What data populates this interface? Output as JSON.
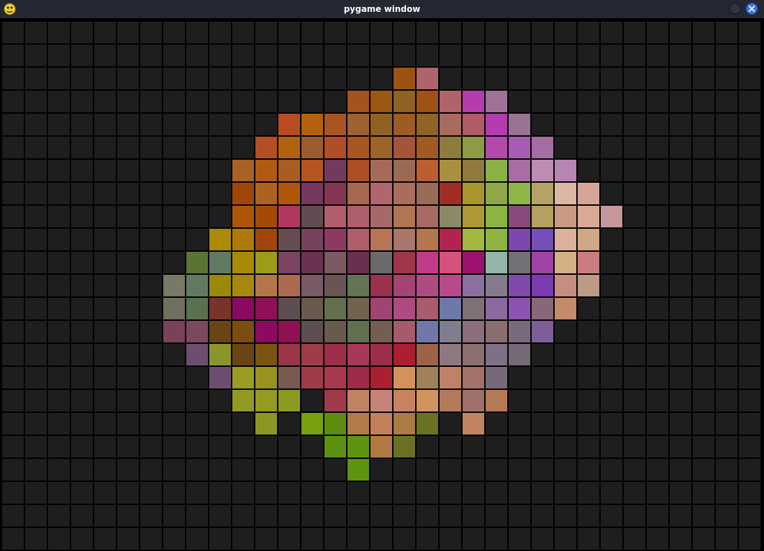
{
  "window": {
    "title": "pygame window",
    "icon": "python-snake-icon",
    "controls": [
      "minimize-icon",
      "close-icon"
    ]
  },
  "board": {
    "columns": 33,
    "rows": 23,
    "empty_color": "#1e1e1e",
    "grid_line_color": "#000000",
    "cells": [
      {
        "r": 2,
        "c": 17,
        "color": "#9c5311"
      },
      {
        "r": 2,
        "c": 18,
        "color": "#b1636b"
      },
      {
        "r": 3,
        "c": 15,
        "color": "#a4521e"
      },
      {
        "r": 3,
        "c": 16,
        "color": "#9c5711"
      },
      {
        "r": 3,
        "c": 17,
        "color": "#8d6223"
      },
      {
        "r": 3,
        "c": 18,
        "color": "#9e5214"
      },
      {
        "r": 3,
        "c": 19,
        "color": "#b0636b"
      },
      {
        "r": 3,
        "c": 20,
        "color": "#b33dac"
      },
      {
        "r": 3,
        "c": 21,
        "color": "#9e7395"
      },
      {
        "r": 4,
        "c": 12,
        "color": "#b84d22"
      },
      {
        "r": 4,
        "c": 13,
        "color": "#b4610c"
      },
      {
        "r": 4,
        "c": 14,
        "color": "#a85523"
      },
      {
        "r": 4,
        "c": 15,
        "color": "#9e6232"
      },
      {
        "r": 4,
        "c": 16,
        "color": "#906222"
      },
      {
        "r": 4,
        "c": 17,
        "color": "#9c5c24"
      },
      {
        "r": 4,
        "c": 18,
        "color": "#8f6424"
      },
      {
        "r": 4,
        "c": 19,
        "color": "#a76c5d"
      },
      {
        "r": 4,
        "c": 20,
        "color": "#b15b67"
      },
      {
        "r": 4,
        "c": 21,
        "color": "#b33db0"
      },
      {
        "r": 4,
        "c": 22,
        "color": "#9a7393"
      },
      {
        "r": 5,
        "c": 11,
        "color": "#b44e24"
      },
      {
        "r": 5,
        "c": 12,
        "color": "#b2620c"
      },
      {
        "r": 5,
        "c": 13,
        "color": "#9c5c32"
      },
      {
        "r": 5,
        "c": 14,
        "color": "#b04e27"
      },
      {
        "r": 5,
        "c": 15,
        "color": "#a85722"
      },
      {
        "r": 5,
        "c": 16,
        "color": "#9c6425"
      },
      {
        "r": 5,
        "c": 17,
        "color": "#a35539"
      },
      {
        "r": 5,
        "c": 18,
        "color": "#a35a22"
      },
      {
        "r": 5,
        "c": 19,
        "color": "#8e7c3c"
      },
      {
        "r": 5,
        "c": 20,
        "color": "#8e9a48"
      },
      {
        "r": 5,
        "c": 21,
        "color": "#b34aaa"
      },
      {
        "r": 5,
        "c": 22,
        "color": "#a85bb5"
      },
      {
        "r": 5,
        "c": 23,
        "color": "#a66ca6"
      },
      {
        "r": 6,
        "c": 10,
        "color": "#a86224"
      },
      {
        "r": 6,
        "c": 11,
        "color": "#b05a14"
      },
      {
        "r": 6,
        "c": 12,
        "color": "#a65e22"
      },
      {
        "r": 6,
        "c": 13,
        "color": "#b55620"
      },
      {
        "r": 6,
        "c": 14,
        "color": "#723b5e"
      },
      {
        "r": 6,
        "c": 15,
        "color": "#ae4e26"
      },
      {
        "r": 6,
        "c": 16,
        "color": "#a86a58"
      },
      {
        "r": 6,
        "c": 17,
        "color": "#9a6a55"
      },
      {
        "r": 6,
        "c": 18,
        "color": "#bb5f32"
      },
      {
        "r": 6,
        "c": 19,
        "color": "#a89040"
      },
      {
        "r": 6,
        "c": 20,
        "color": "#907a40"
      },
      {
        "r": 6,
        "c": 21,
        "color": "#8ab046"
      },
      {
        "r": 6,
        "c": 22,
        "color": "#a86ea4"
      },
      {
        "r": 6,
        "c": 23,
        "color": "#bc8cb2"
      },
      {
        "r": 6,
        "c": 24,
        "color": "#b884b2"
      },
      {
        "r": 7,
        "c": 10,
        "color": "#a24608"
      },
      {
        "r": 7,
        "c": 11,
        "color": "#ae6222"
      },
      {
        "r": 7,
        "c": 12,
        "color": "#b0560a"
      },
      {
        "r": 7,
        "c": 13,
        "color": "#74375e"
      },
      {
        "r": 7,
        "c": 14,
        "color": "#843650"
      },
      {
        "r": 7,
        "c": 15,
        "color": "#a8684e"
      },
      {
        "r": 7,
        "c": 16,
        "color": "#b0666c"
      },
      {
        "r": 7,
        "c": 17,
        "color": "#aa6c5e"
      },
      {
        "r": 7,
        "c": 18,
        "color": "#9a6c58"
      },
      {
        "r": 7,
        "c": 19,
        "color": "#a02e22"
      },
      {
        "r": 7,
        "c": 20,
        "color": "#a8962c"
      },
      {
        "r": 7,
        "c": 21,
        "color": "#8ea848"
      },
      {
        "r": 7,
        "c": 22,
        "color": "#8db646"
      },
      {
        "r": 7,
        "c": 23,
        "color": "#b4a364"
      },
      {
        "r": 7,
        "c": 24,
        "color": "#dab7a4"
      },
      {
        "r": 7,
        "c": 25,
        "color": "#d6a59a"
      },
      {
        "r": 8,
        "c": 10,
        "color": "#ae5608"
      },
      {
        "r": 8,
        "c": 11,
        "color": "#a34a08"
      },
      {
        "r": 8,
        "c": 12,
        "color": "#b0385e"
      },
      {
        "r": 8,
        "c": 13,
        "color": "#624c52"
      },
      {
        "r": 8,
        "c": 14,
        "color": "#b05e6c"
      },
      {
        "r": 8,
        "c": 15,
        "color": "#ae5e6c"
      },
      {
        "r": 8,
        "c": 16,
        "color": "#a8686a"
      },
      {
        "r": 8,
        "c": 17,
        "color": "#b07654"
      },
      {
        "r": 8,
        "c": 18,
        "color": "#a86a62"
      },
      {
        "r": 8,
        "c": 19,
        "color": "#8a8a68"
      },
      {
        "r": 8,
        "c": 20,
        "color": "#b09834"
      },
      {
        "r": 8,
        "c": 21,
        "color": "#8cb442"
      },
      {
        "r": 8,
        "c": 22,
        "color": "#884a7a"
      },
      {
        "r": 8,
        "c": 23,
        "color": "#b4a060"
      },
      {
        "r": 8,
        "c": 24,
        "color": "#c89a84"
      },
      {
        "r": 8,
        "c": 25,
        "color": "#d8aa96"
      },
      {
        "r": 8,
        "c": 26,
        "color": "#c8979c"
      },
      {
        "r": 9,
        "c": 9,
        "color": "#aa8a06"
      },
      {
        "r": 9,
        "c": 10,
        "color": "#ae7a08"
      },
      {
        "r": 9,
        "c": 11,
        "color": "#a04608"
      },
      {
        "r": 9,
        "c": 12,
        "color": "#644e52"
      },
      {
        "r": 9,
        "c": 13,
        "color": "#78425e"
      },
      {
        "r": 9,
        "c": 14,
        "color": "#8c3a62"
      },
      {
        "r": 9,
        "c": 15,
        "color": "#b05e6c"
      },
      {
        "r": 9,
        "c": 16,
        "color": "#b87454"
      },
      {
        "r": 9,
        "c": 17,
        "color": "#a8766a"
      },
      {
        "r": 9,
        "c": 18,
        "color": "#b47650"
      },
      {
        "r": 9,
        "c": 19,
        "color": "#b42350"
      },
      {
        "r": 9,
        "c": 20,
        "color": "#a4b840"
      },
      {
        "r": 9,
        "c": 21,
        "color": "#8eb444"
      },
      {
        "r": 9,
        "c": 22,
        "color": "#7c48b0"
      },
      {
        "r": 9,
        "c": 23,
        "color": "#7650b8"
      },
      {
        "r": 9,
        "c": 24,
        "color": "#dcb09a"
      },
      {
        "r": 9,
        "c": 25,
        "color": "#d0a884"
      },
      {
        "r": 10,
        "c": 8,
        "color": "#5a7434"
      },
      {
        "r": 10,
        "c": 9,
        "color": "#627a62"
      },
      {
        "r": 10,
        "c": 10,
        "color": "#a88a08"
      },
      {
        "r": 10,
        "c": 11,
        "color": "#9a9c1a"
      },
      {
        "r": 10,
        "c": 12,
        "color": "#7c4462"
      },
      {
        "r": 10,
        "c": 13,
        "color": "#6c3252"
      },
      {
        "r": 10,
        "c": 14,
        "color": "#7c5a62"
      },
      {
        "r": 10,
        "c": 15,
        "color": "#6a3050"
      },
      {
        "r": 10,
        "c": 16,
        "color": "#6a6a6a"
      },
      {
        "r": 10,
        "c": 17,
        "color": "#a0364a"
      },
      {
        "r": 10,
        "c": 18,
        "color": "#c03c8a"
      },
      {
        "r": 10,
        "c": 19,
        "color": "#d4527c"
      },
      {
        "r": 10,
        "c": 20,
        "color": "#9c1470"
      },
      {
        "r": 10,
        "c": 21,
        "color": "#94b4a8"
      },
      {
        "r": 10,
        "c": 22,
        "color": "#747078"
      },
      {
        "r": 10,
        "c": 23,
        "color": "#a042a6"
      },
      {
        "r": 10,
        "c": 24,
        "color": "#d4ae84"
      },
      {
        "r": 10,
        "c": 25,
        "color": "#cc7c80"
      },
      {
        "r": 11,
        "c": 7,
        "color": "#767a66"
      },
      {
        "r": 11,
        "c": 8,
        "color": "#627a62"
      },
      {
        "r": 11,
        "c": 9,
        "color": "#9a8a08"
      },
      {
        "r": 11,
        "c": 10,
        "color": "#a8880a"
      },
      {
        "r": 11,
        "c": 11,
        "color": "#b47848"
      },
      {
        "r": 11,
        "c": 12,
        "color": "#ac6a50"
      },
      {
        "r": 11,
        "c": 13,
        "color": "#7a5a64"
      },
      {
        "r": 11,
        "c": 14,
        "color": "#6a5454"
      },
      {
        "r": 11,
        "c": 15,
        "color": "#647454"
      },
      {
        "r": 11,
        "c": 16,
        "color": "#9c304e"
      },
      {
        "r": 11,
        "c": 17,
        "color": "#a44474"
      },
      {
        "r": 11,
        "c": 18,
        "color": "#ae4c82"
      },
      {
        "r": 11,
        "c": 19,
        "color": "#b84a8c"
      },
      {
        "r": 11,
        "c": 20,
        "color": "#8c70a0"
      },
      {
        "r": 11,
        "c": 21,
        "color": "#847c8c"
      },
      {
        "r": 11,
        "c": 22,
        "color": "#804aac"
      },
      {
        "r": 11,
        "c": 23,
        "color": "#7a3cb0"
      },
      {
        "r": 11,
        "c": 24,
        "color": "#c48e80"
      },
      {
        "r": 11,
        "c": 25,
        "color": "#bc9a88"
      },
      {
        "r": 12,
        "c": 7,
        "color": "#707060"
      },
      {
        "r": 12,
        "c": 8,
        "color": "#5a7050"
      },
      {
        "r": 12,
        "c": 9,
        "color": "#78342a"
      },
      {
        "r": 12,
        "c": 10,
        "color": "#8a0a62"
      },
      {
        "r": 12,
        "c": 11,
        "color": "#901058"
      },
      {
        "r": 12,
        "c": 12,
        "color": "#5e4e52"
      },
      {
        "r": 12,
        "c": 13,
        "color": "#6a5a4e"
      },
      {
        "r": 12,
        "c": 14,
        "color": "#627050"
      },
      {
        "r": 12,
        "c": 15,
        "color": "#726250"
      },
      {
        "r": 12,
        "c": 16,
        "color": "#a04474"
      },
      {
        "r": 12,
        "c": 17,
        "color": "#ae4c82"
      },
      {
        "r": 12,
        "c": 18,
        "color": "#a85c6c"
      },
      {
        "r": 12,
        "c": 19,
        "color": "#6e78aa"
      },
      {
        "r": 12,
        "c": 20,
        "color": "#807078"
      },
      {
        "r": 12,
        "c": 21,
        "color": "#8c6aa0"
      },
      {
        "r": 12,
        "c": 22,
        "color": "#8e52b0"
      },
      {
        "r": 12,
        "c": 23,
        "color": "#866878"
      },
      {
        "r": 12,
        "c": 24,
        "color": "#c48a6c"
      },
      {
        "r": 13,
        "c": 7,
        "color": "#7a4258"
      },
      {
        "r": 13,
        "c": 8,
        "color": "#7c4a5e"
      },
      {
        "r": 13,
        "c": 9,
        "color": "#6a4416"
      },
      {
        "r": 13,
        "c": 10,
        "color": "#7a4e0e"
      },
      {
        "r": 13,
        "c": 11,
        "color": "#8c0a62"
      },
      {
        "r": 13,
        "c": 12,
        "color": "#901054"
      },
      {
        "r": 13,
        "c": 13,
        "color": "#5e4e52"
      },
      {
        "r": 13,
        "c": 14,
        "color": "#6a5a4e"
      },
      {
        "r": 13,
        "c": 15,
        "color": "#627050"
      },
      {
        "r": 13,
        "c": 16,
        "color": "#745e50"
      },
      {
        "r": 13,
        "c": 17,
        "color": "#a65a6c"
      },
      {
        "r": 13,
        "c": 18,
        "color": "#7078aa"
      },
      {
        "r": 13,
        "c": 19,
        "color": "#7e7e8e"
      },
      {
        "r": 13,
        "c": 20,
        "color": "#8c6e7c"
      },
      {
        "r": 13,
        "c": 21,
        "color": "#8a6e6e"
      },
      {
        "r": 13,
        "c": 22,
        "color": "#7a6a7e"
      },
      {
        "r": 13,
        "c": 23,
        "color": "#7c5e98"
      },
      {
        "r": 14,
        "c": 8,
        "color": "#6e4e6e"
      },
      {
        "r": 14,
        "c": 9,
        "color": "#8a962c"
      },
      {
        "r": 14,
        "c": 10,
        "color": "#6a4416"
      },
      {
        "r": 14,
        "c": 11,
        "color": "#7a5412"
      },
      {
        "r": 14,
        "c": 12,
        "color": "#9a3646"
      },
      {
        "r": 14,
        "c": 13,
        "color": "#a03c4a"
      },
      {
        "r": 14,
        "c": 14,
        "color": "#9c2e4a"
      },
      {
        "r": 14,
        "c": 15,
        "color": "#a8385a"
      },
      {
        "r": 14,
        "c": 16,
        "color": "#9c2e4a"
      },
      {
        "r": 14,
        "c": 17,
        "color": "#ac1e30"
      },
      {
        "r": 14,
        "c": 18,
        "color": "#9e6246"
      },
      {
        "r": 14,
        "c": 19,
        "color": "#907880"
      },
      {
        "r": 14,
        "c": 20,
        "color": "#8a7070"
      },
      {
        "r": 14,
        "c": 21,
        "color": "#7e7086"
      },
      {
        "r": 14,
        "c": 22,
        "color": "#766878"
      },
      {
        "r": 15,
        "c": 9,
        "color": "#6e4e6e"
      },
      {
        "r": 15,
        "c": 10,
        "color": "#9a9c24"
      },
      {
        "r": 15,
        "c": 11,
        "color": "#98921e"
      },
      {
        "r": 15,
        "c": 12,
        "color": "#785a50"
      },
      {
        "r": 15,
        "c": 13,
        "color": "#a03c4a"
      },
      {
        "r": 15,
        "c": 14,
        "color": "#a8384e"
      },
      {
        "r": 15,
        "c": 15,
        "color": "#9e2a48"
      },
      {
        "r": 15,
        "c": 16,
        "color": "#aa2030"
      },
      {
        "r": 15,
        "c": 17,
        "color": "#d4925a"
      },
      {
        "r": 15,
        "c": 18,
        "color": "#a0825a"
      },
      {
        "r": 15,
        "c": 19,
        "color": "#c08266"
      },
      {
        "r": 15,
        "c": 20,
        "color": "#a4726a"
      },
      {
        "r": 15,
        "c": 21,
        "color": "#766a7a"
      },
      {
        "r": 16,
        "c": 10,
        "color": "#929a22"
      },
      {
        "r": 16,
        "c": 11,
        "color": "#949a22"
      },
      {
        "r": 16,
        "c": 12,
        "color": "#8c9a20"
      },
      {
        "r": 16,
        "c": 14,
        "color": "#9e3a4a"
      },
      {
        "r": 16,
        "c": 15,
        "color": "#c28262"
      },
      {
        "r": 16,
        "c": 16,
        "color": "#c4847a"
      },
      {
        "r": 16,
        "c": 17,
        "color": "#c6845e"
      },
      {
        "r": 16,
        "c": 18,
        "color": "#d2945e"
      },
      {
        "r": 16,
        "c": 19,
        "color": "#b27a5a"
      },
      {
        "r": 16,
        "c": 20,
        "color": "#a0706a"
      },
      {
        "r": 16,
        "c": 21,
        "color": "#b47a56"
      },
      {
        "r": 17,
        "c": 11,
        "color": "#8e9622"
      },
      {
        "r": 17,
        "c": 13,
        "color": "#78a00e"
      },
      {
        "r": 17,
        "c": 14,
        "color": "#5e8e10"
      },
      {
        "r": 17,
        "c": 15,
        "color": "#b27a48"
      },
      {
        "r": 17,
        "c": 16,
        "color": "#c2805a"
      },
      {
        "r": 17,
        "c": 17,
        "color": "#aa7c42"
      },
      {
        "r": 17,
        "c": 18,
        "color": "#6a7222"
      },
      {
        "r": 17,
        "c": 20,
        "color": "#c08460"
      },
      {
        "r": 18,
        "c": 14,
        "color": "#5e9010"
      },
      {
        "r": 18,
        "c": 15,
        "color": "#5e9410"
      },
      {
        "r": 18,
        "c": 16,
        "color": "#b27a42"
      },
      {
        "r": 18,
        "c": 17,
        "color": "#6a7024"
      },
      {
        "r": 19,
        "c": 15,
        "color": "#5e9410"
      }
    ]
  }
}
